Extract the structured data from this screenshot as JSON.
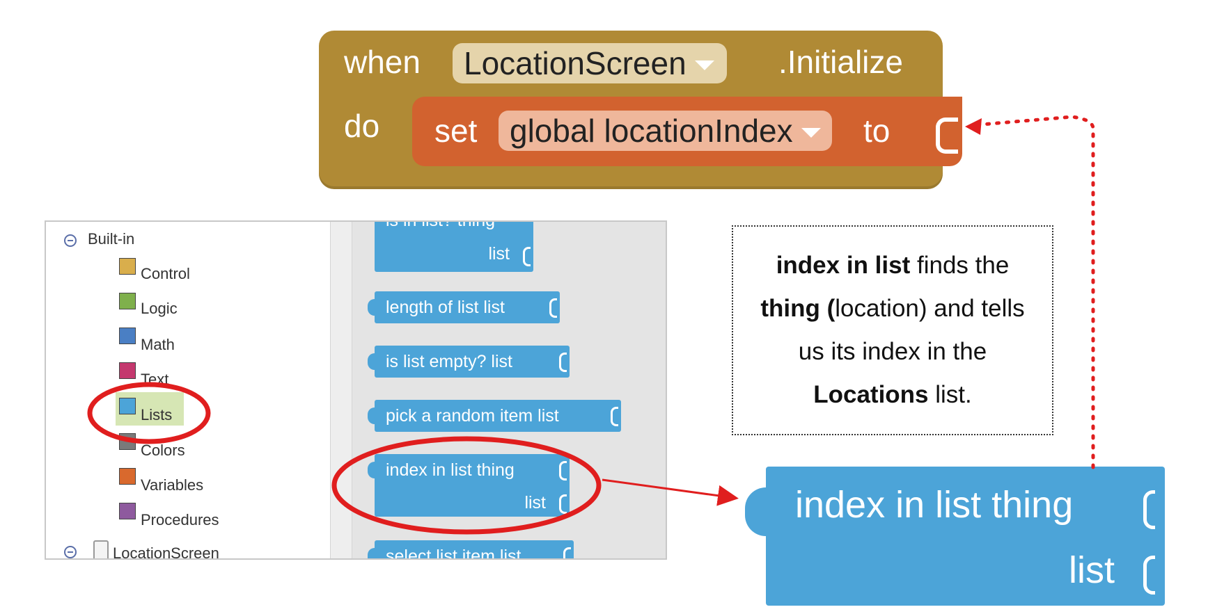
{
  "event_block": {
    "when": "when",
    "component": "LocationScreen",
    "event": ".Initialize",
    "do": "do",
    "set": {
      "keyword": "set",
      "variable": "global locationIndex",
      "to": "to"
    }
  },
  "tree": {
    "builtin_label": "Built-in",
    "categories": [
      {
        "label": "Control",
        "color": "#d9ae4c"
      },
      {
        "label": "Logic",
        "color": "#7fb04c"
      },
      {
        "label": "Math",
        "color": "#4a7fc4"
      },
      {
        "label": "Text",
        "color": "#c4386e"
      },
      {
        "label": "Lists",
        "color": "#4ca4d8"
      },
      {
        "label": "Colors",
        "color": "#7a7a7a"
      },
      {
        "label": "Variables",
        "color": "#d9692d"
      },
      {
        "label": "Procedures",
        "color": "#8e5a9e"
      }
    ],
    "screen_label": "LocationScreen"
  },
  "flyout": {
    "blocks": [
      {
        "text": "is in list? thing",
        "text2": "list"
      },
      {
        "text": "length of list  list"
      },
      {
        "text": "is list empty?  list"
      },
      {
        "text": "pick a random item  list"
      },
      {
        "text": "index in list  thing",
        "text2": "list"
      },
      {
        "text": "select list item  list"
      }
    ]
  },
  "note": {
    "line1_bold": "index in list",
    "line1_rest": " finds the",
    "line2_bold": "thing (",
    "line2_rest": "location) and tells",
    "line3": "us its index  in the",
    "line4_bold": "Locations",
    "line4_rest": " list."
  },
  "big_block": {
    "line1": "index in list  thing",
    "line2": "list"
  },
  "colors": {
    "event": "#b08a35",
    "set": "#d2622f",
    "lists": "#4ca4d8",
    "highlight_red": "#e01e1e",
    "selected_bg": "#d6e6b4"
  }
}
